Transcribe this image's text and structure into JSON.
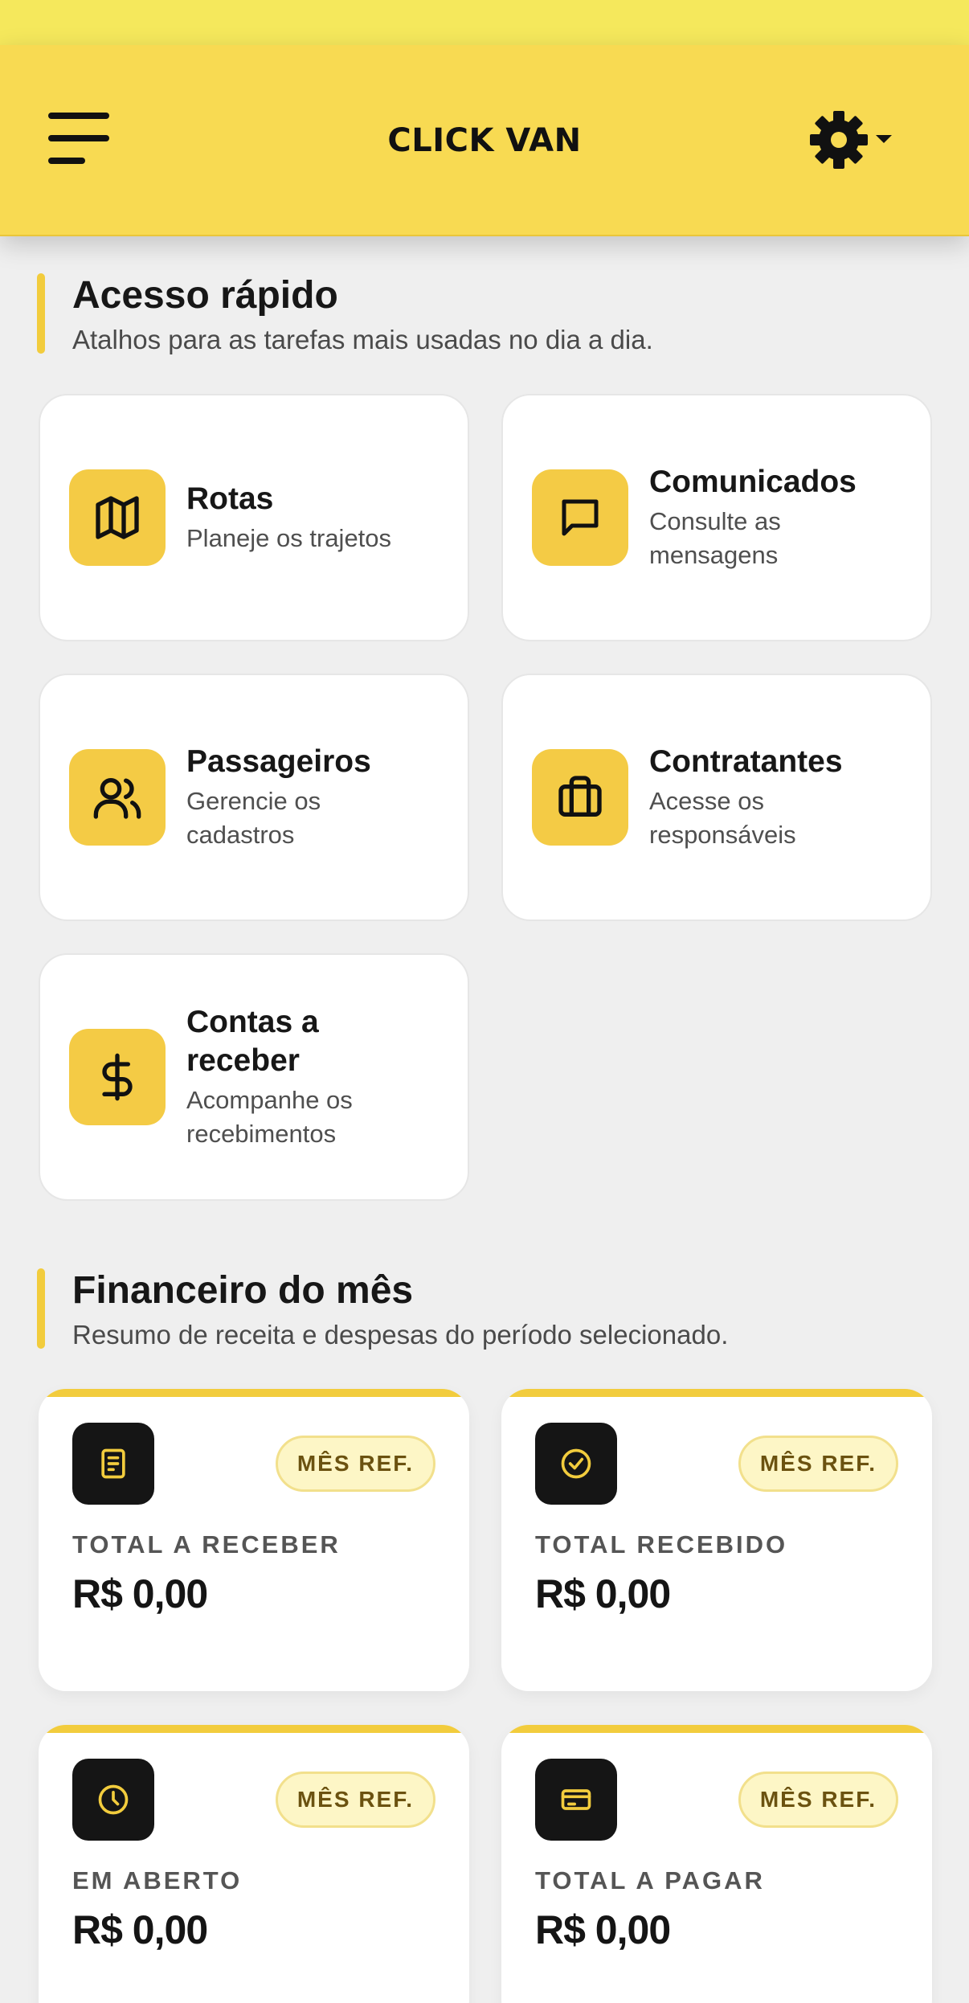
{
  "header": {
    "title": "CLICK VAN"
  },
  "quick_access": {
    "title": "Acesso rápido",
    "subtitle": "Atalhos para as tarefas mais usadas no dia a dia.",
    "items": [
      {
        "title": "Rotas",
        "desc": "Planeje os trajetos",
        "icon": "map-icon"
      },
      {
        "title": "Comunicados",
        "desc": "Consulte as mensagens",
        "icon": "message-icon"
      },
      {
        "title": "Passageiros",
        "desc": "Gerencie os cadastros",
        "icon": "users-icon"
      },
      {
        "title": "Contratantes",
        "desc": "Acesse os responsáveis",
        "icon": "briefcase-icon"
      },
      {
        "title": "Contas a receber",
        "desc": "Acompanhe os recebimentos",
        "icon": "dollar-icon"
      }
    ]
  },
  "finance": {
    "title": "Financeiro do mês",
    "subtitle": "Resumo de receita e despesas do período selecionado.",
    "cards": [
      {
        "label": "TOTAL A RECEBER",
        "value": "R$ 0,00",
        "badge": "MÊS REF.",
        "icon": "document-icon"
      },
      {
        "label": "TOTAL RECEBIDO",
        "value": "R$ 0,00",
        "badge": "MÊS REF.",
        "icon": "check-circle-icon"
      },
      {
        "label": "EM ABERTO",
        "value": "R$ 0,00",
        "badge": "MÊS REF.",
        "icon": "clock-icon"
      },
      {
        "label": "TOTAL A PAGAR",
        "value": "R$ 0,00",
        "badge": "MÊS REF.",
        "icon": "credit-card-icon"
      }
    ]
  },
  "colors": {
    "header": "#f8da52",
    "accent": "#f2cc3d",
    "status_bar": "#f5e85c"
  }
}
